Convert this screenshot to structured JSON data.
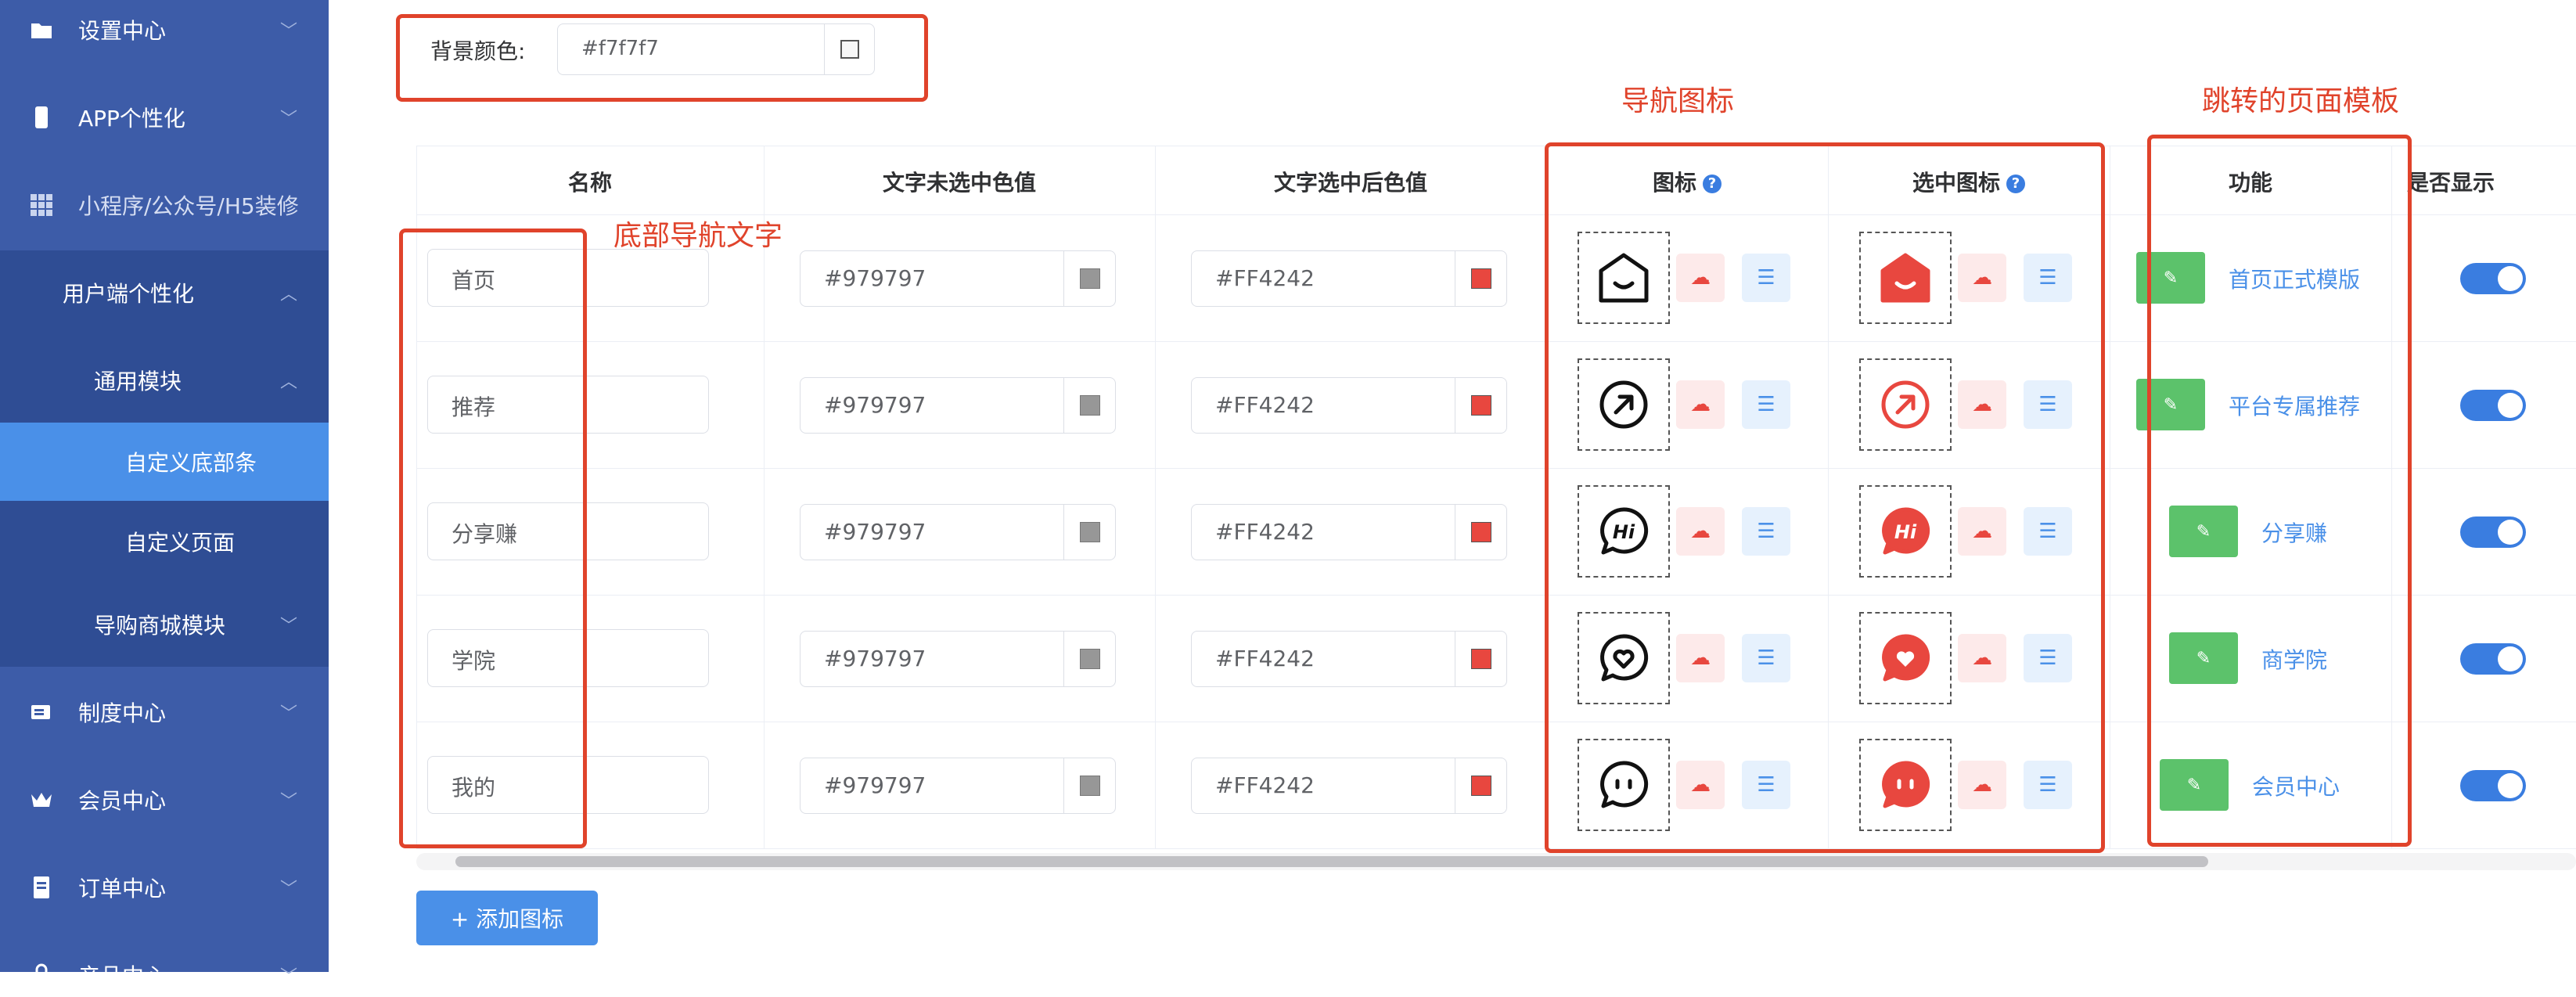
{
  "sidebar": {
    "items": [
      {
        "label": "设置中心",
        "icon": "folder-icon"
      },
      {
        "label": "APP个性化",
        "icon": "phone-icon"
      },
      {
        "label": "小程序/公众号/H5装修",
        "icon": "grid-icon"
      },
      {
        "label": "用户端个性化"
      },
      {
        "label": "通用模块"
      },
      {
        "label": "自定义底部条"
      },
      {
        "label": "自定义页面"
      },
      {
        "label": "导购商城模块"
      },
      {
        "label": "制度中心",
        "icon": "ticket-icon"
      },
      {
        "label": "会员中心",
        "icon": "crown-icon"
      },
      {
        "label": "订单中心",
        "icon": "document-icon"
      },
      {
        "label": "产品中心",
        "icon": "lock-icon"
      }
    ]
  },
  "background": {
    "label": "背景颜色:",
    "value": "#f7f7f7"
  },
  "table": {
    "headers": {
      "name": "名称",
      "unselected": "文字未选中色值",
      "selected": "文字选中后色值",
      "icon": "图标",
      "selected_icon": "选中图标",
      "function": "功能",
      "show": "是否显示"
    },
    "rows": [
      {
        "name": "首页",
        "unselected": "#979797",
        "selected": "#FF4242",
        "icon": "home-icon",
        "page": "首页正式模版"
      },
      {
        "name": "推荐",
        "unselected": "#979797",
        "selected": "#FF4242",
        "icon": "arrow-icon",
        "page": "平台专属推荐"
      },
      {
        "name": "分享赚",
        "unselected": "#979797",
        "selected": "#FF4242",
        "icon": "hi-chat-icon",
        "page": "分享赚"
      },
      {
        "name": "学院",
        "unselected": "#979797",
        "selected": "#FF4242",
        "icon": "heart-chat-icon",
        "page": "商学院"
      },
      {
        "name": "我的",
        "unselected": "#979797",
        "selected": "#FF4242",
        "icon": "face-icon",
        "page": "会员中心"
      }
    ]
  },
  "add_button": "+ 添加图标",
  "annotations": {
    "nav_text": "底部导航文字",
    "nav_icon": "导航图标",
    "page_template": "跳转的页面模板"
  },
  "colors": {
    "sidebar": "#3d5ca8",
    "accent": "#4a90e8",
    "red": "#e0432b",
    "unselected": "#979797",
    "selected": "#FF4242",
    "green": "#5cc26b"
  }
}
